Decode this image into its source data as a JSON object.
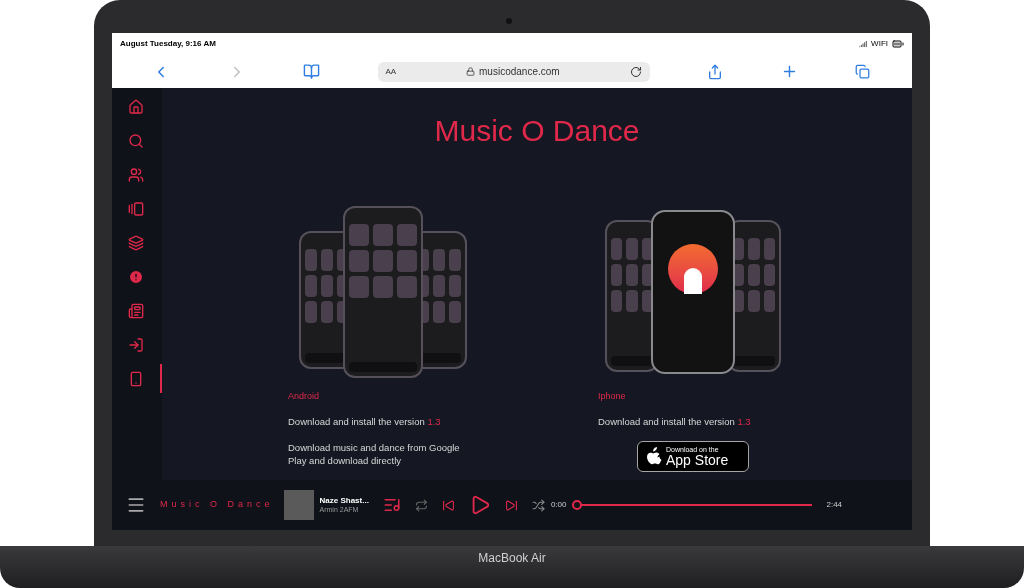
{
  "status_bar": {
    "date_time": "August Tuesday, 9:16 AM",
    "network": "WIFI"
  },
  "browser": {
    "text_size": "AA",
    "url": "musicodance.com"
  },
  "sidebar": {
    "items": [
      {
        "selected": false
      },
      {
        "selected": false
      },
      {
        "selected": false
      },
      {
        "selected": false
      },
      {
        "selected": false
      },
      {
        "selected": false
      },
      {
        "selected": false
      },
      {
        "selected": false
      },
      {
        "selected": true
      }
    ]
  },
  "page": {
    "title": "Music O Dance",
    "platforms": [
      {
        "kind": "android",
        "name": "Android",
        "install_text": "Download and install the version",
        "version": "1.3",
        "description": "Download music and dance from Google Play and download directly"
      },
      {
        "kind": "iphone",
        "name": "Iphone",
        "install_text": "Download and install the version",
        "version": "1.3",
        "store_button": {
          "small": "Download on the",
          "large": "App Store"
        }
      }
    ]
  },
  "player": {
    "brand": "Music O Dance",
    "track": {
      "title": "Naze Shast...",
      "artist": "Armin 2AFM"
    },
    "elapsed": "0:00",
    "duration": "2:44",
    "level": 0
  },
  "device": {
    "label": "MacBook Air"
  }
}
